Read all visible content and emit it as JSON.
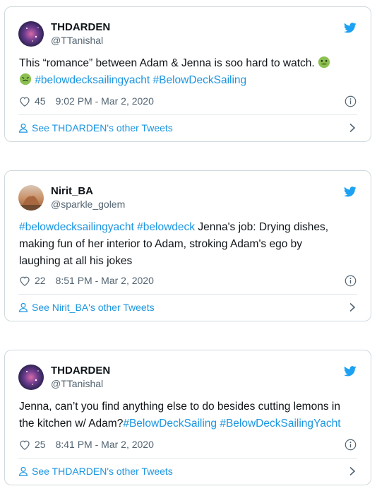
{
  "tweets": [
    {
      "name": "THDARDEN",
      "handle": "@TTanishal",
      "text_pre": "This “romance” between Adam & Jenna is soo hard to watch.",
      "tag1": "#belowdecksailingyacht",
      "tag2": "#BelowDeckSailing",
      "likes": "45",
      "time": "9:02 PM - Mar 2, 2020",
      "footer": "See THDARDEN's other Tweets"
    },
    {
      "name": "Nirit_BA",
      "handle": "@sparkle_golem",
      "tag1": "#belowdecksailingyacht",
      "tag2": "#belowdeck",
      "text_l1_rest": " Jenna's job: Drying dishes,",
      "text_l2": "making fun of her interior to Adam, stroking Adam's ego by",
      "text_l3": "laughing at all his jokes",
      "likes": "22",
      "time": "8:51 PM - Mar 2, 2020",
      "footer": "See Nirit_BA's other Tweets"
    },
    {
      "name": "THDARDEN",
      "handle": "@TTanishal",
      "text_l1": "Jenna, can’t you find anything else to do besides cutting lemons in",
      "text_l2_pre": "the kitchen w/ Adam?",
      "tag1": "#BelowDeckSailing",
      "tag2": "#BelowDeckSailingYacht",
      "likes": "25",
      "time": "8:41 PM - Mar 2, 2020",
      "footer": "See THDARDEN's other Tweets"
    }
  ],
  "colors": {
    "link": "#1b95e0",
    "border": "#cfd9de",
    "muted": "#536471"
  },
  "icons": [
    "twitter-bird-icon",
    "heart-icon",
    "info-icon",
    "user-icon",
    "chevron-right-icon",
    "nauseated-face-emoji"
  ]
}
